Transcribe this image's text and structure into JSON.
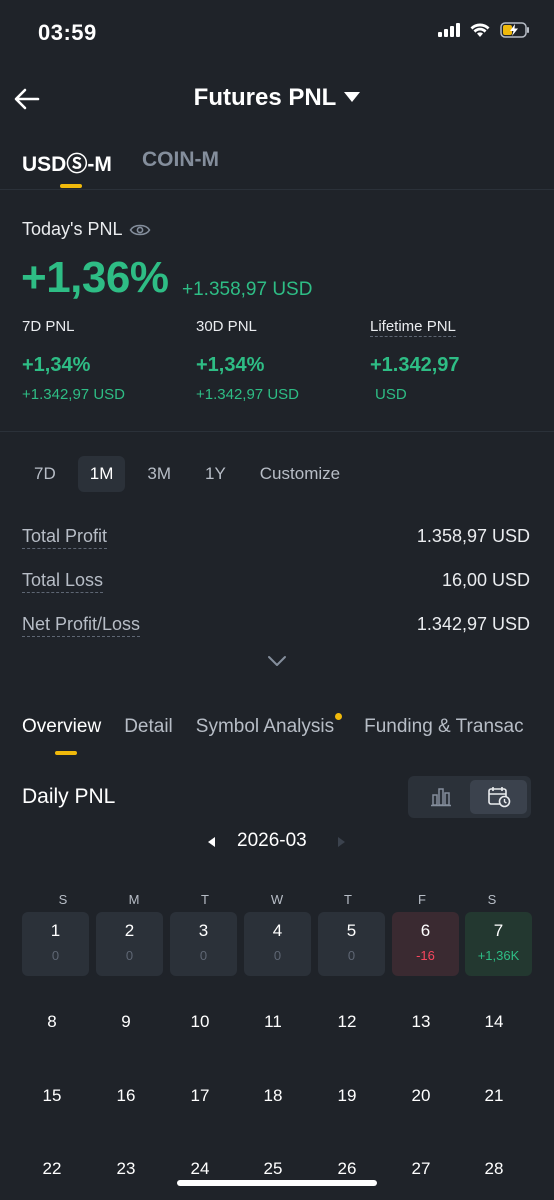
{
  "status_bar": {
    "time": "03:59"
  },
  "header": {
    "title": "Futures PNL"
  },
  "market_tabs": [
    {
      "label": "USDⓈ-M"
    },
    {
      "label": "COIN-M"
    }
  ],
  "today": {
    "label": "Today's PNL",
    "percent": "+1,36%",
    "usd": "+1.358,97 USD"
  },
  "summary": [
    {
      "label": "7D PNL",
      "value": "+1,34%",
      "sub": "+1.342,97 USD"
    },
    {
      "label": "30D PNL",
      "value": "+1,34%",
      "sub": "+1.342,97 USD"
    },
    {
      "label": "Lifetime PNL",
      "value": "+1.342,97",
      "sub": "USD"
    }
  ],
  "periods": [
    {
      "label": "7D"
    },
    {
      "label": "1M"
    },
    {
      "label": "3M"
    },
    {
      "label": "1Y"
    },
    {
      "label": "Customize"
    }
  ],
  "totals": [
    {
      "label": "Total Profit",
      "value": "1.358,97 USD"
    },
    {
      "label": "Total Loss",
      "value": "16,00 USD"
    },
    {
      "label": "Net Profit/Loss",
      "value": "1.342,97 USD"
    }
  ],
  "section_tabs": [
    {
      "label": "Overview"
    },
    {
      "label": "Detail"
    },
    {
      "label": "Symbol Analysis"
    },
    {
      "label": "Funding & Transac"
    }
  ],
  "daily": {
    "title": "Daily PNL",
    "month": "2026-03",
    "weekdays": [
      "S",
      "M",
      "T",
      "W",
      "T",
      "F",
      "S"
    ],
    "first_week": [
      {
        "day": "1",
        "pnl": "0"
      },
      {
        "day": "2",
        "pnl": "0"
      },
      {
        "day": "3",
        "pnl": "0"
      },
      {
        "day": "4",
        "pnl": "0"
      },
      {
        "day": "5",
        "pnl": "0"
      },
      {
        "day": "6",
        "pnl": "-16"
      },
      {
        "day": "7",
        "pnl": "+1,36K"
      }
    ],
    "week2": [
      "8",
      "9",
      "10",
      "11",
      "12",
      "13",
      "14"
    ],
    "week3": [
      "15",
      "16",
      "17",
      "18",
      "19",
      "20",
      "21"
    ],
    "week4": [
      "22",
      "23",
      "24",
      "25",
      "26",
      "27",
      "28"
    ]
  },
  "colors": {
    "profit": "#2ebd85",
    "loss": "#f6465d",
    "accent": "#f0b90b",
    "background": "#1f2329"
  }
}
